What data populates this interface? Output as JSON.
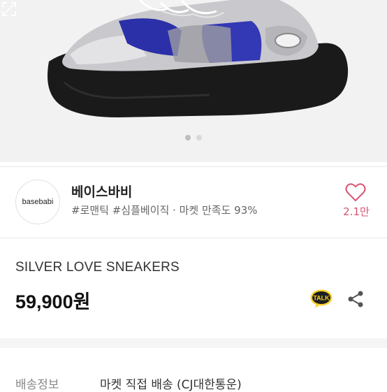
{
  "store": {
    "logo_text": "basebabi",
    "name": "베이스바비",
    "tags": "#로맨틱 #심플베이직 · 마켓 만족도 93%",
    "likes": "2.1만"
  },
  "product": {
    "name": "SILVER LOVE SNEAKERS",
    "price": "59,900원"
  },
  "buttons": {
    "talk_label": "TALK"
  },
  "gallery": {
    "slide_count": 2,
    "active_slide": 1
  },
  "shipping": {
    "label": "배송정보",
    "value": "마켓 직접 배송 (CJ대한통운)"
  },
  "colors": {
    "heart": "#d9536f",
    "talk_bg": "#1e1e1e",
    "talk_yellow": "#f7d12b"
  }
}
